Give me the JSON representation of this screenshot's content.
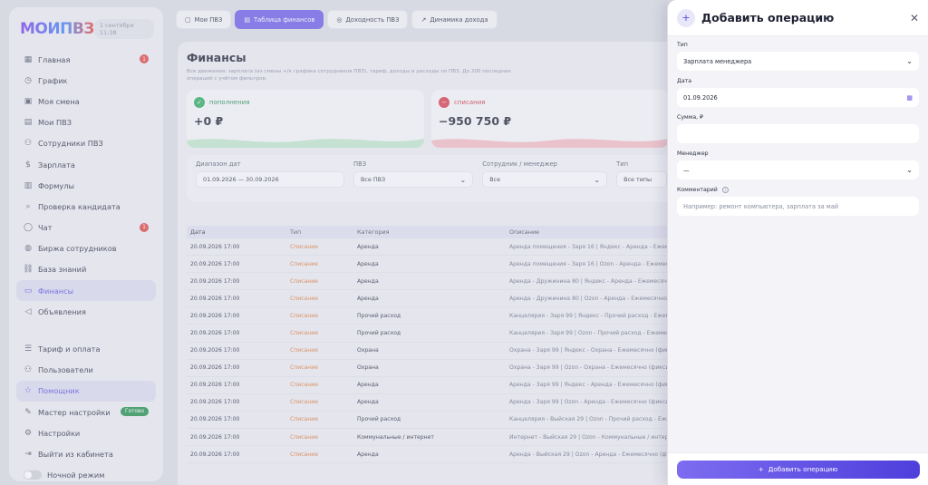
{
  "app": {
    "logo": "МОИПВЗ",
    "date": "1 сентября 11:38"
  },
  "sidebar": {
    "items": [
      {
        "name": "glavnaya",
        "icon": "grid",
        "label": "Главная",
        "badge": "1"
      },
      {
        "name": "grafik",
        "icon": "clock",
        "label": "График"
      },
      {
        "name": "moya-smena",
        "icon": "calendar",
        "label": "Моя смена"
      },
      {
        "name": "moi-pvz",
        "icon": "boxes",
        "label": "Мои ПВЗ"
      },
      {
        "name": "sotrudniki",
        "icon": "people",
        "label": "Сотрудники ПВЗ"
      },
      {
        "name": "zarplata",
        "icon": "dollar",
        "label": "Зарплата"
      },
      {
        "name": "formuly",
        "icon": "calc",
        "label": "Формулы"
      },
      {
        "name": "proverka",
        "icon": "search",
        "label": "Проверка кандидата"
      },
      {
        "name": "chat",
        "icon": "chat",
        "label": "Чат",
        "badge": "1"
      },
      {
        "name": "birzha",
        "icon": "globe",
        "label": "Биржа сотрудников"
      },
      {
        "name": "baza",
        "icon": "link",
        "label": "База знаний"
      },
      {
        "name": "finansy",
        "icon": "wallet",
        "label": "Финансы",
        "active": true
      },
      {
        "name": "obyavleniya",
        "icon": "megaphone",
        "label": "Объявления"
      }
    ],
    "items2": [
      {
        "name": "tarif",
        "icon": "list",
        "label": "Тариф и оплата"
      },
      {
        "name": "polzovateli",
        "icon": "users",
        "label": "Пользователи"
      },
      {
        "name": "pomoshnik",
        "icon": "star",
        "label": "Помощник",
        "active": true
      },
      {
        "name": "master",
        "icon": "pencil",
        "label": "Мастер настройки",
        "ready": "Готово"
      },
      {
        "name": "nastroyki",
        "icon": "gear",
        "label": "Настройки"
      },
      {
        "name": "vyiti",
        "icon": "exit",
        "label": "Выйти из кабинета"
      }
    ],
    "night_mode": "Ночной режим"
  },
  "tabs": [
    {
      "icon": "box",
      "label": "Мои ПВЗ"
    },
    {
      "icon": "table",
      "label": "Таблица финансов",
      "active": true
    },
    {
      "icon": "coins",
      "label": "Доходность ПВЗ"
    },
    {
      "icon": "trend",
      "label": "Динамика дохода"
    }
  ],
  "finance": {
    "title": "Финансы",
    "subtitle": "Все движения: зарплата (из смены +/к графика сотрудников ПВЗ), тариф, доходы и расходы по ПВЗ. До 200 последних операций с учётом фильтров.",
    "income_label": "пополнения",
    "income_value": "+0 ₽",
    "expense_label": "списания",
    "expense_value": "−950 750 ₽",
    "filters": {
      "range_label": "Диапазон дат",
      "range_value": "01.09.2026 — 30.09.2026",
      "pvz_label": "ПВЗ",
      "pvz_value": "Все ПВЗ",
      "employee_label": "Сотрудник / менеджер",
      "employee_value": "Все",
      "type_label": "Тип",
      "type_value": "Все типы"
    },
    "columns": [
      "Дата",
      "Тип",
      "Категория",
      "Описание"
    ],
    "rows": [
      [
        "20.09.2026 17:00",
        "Списание",
        "Аренда",
        "Аренда помещения - Заря 16 | Яндекс - Аренда - Ежемесячно (фиксир"
      ],
      [
        "20.09.2026 17:00",
        "Списание",
        "Аренда",
        "Аренда помещения - Заря 16 | Ozon - Аренда - Ежемесячно (фиксир"
      ],
      [
        "20.09.2026 17:00",
        "Списание",
        "Аренда",
        "Аренда - Дружинина 80 | Яндекс - Аренда - Ежемесячно (фиксир"
      ],
      [
        "20.09.2026 17:00",
        "Списание",
        "Аренда",
        "Аренда - Дружинина 80 | Ozon - Аренда - Ежемесячно (фиксир"
      ],
      [
        "20.09.2026 17:00",
        "Списание",
        "Прочий расход",
        "Канцелярия - Заря 99 | Яндекс - Прочий расход - Ежемесячно"
      ],
      [
        "20.09.2026 17:00",
        "Списание",
        "Прочий расход",
        "Канцелярия - Заря 99 | Ozon - Прочий расход - Ежемесячно"
      ],
      [
        "20.09.2026 17:00",
        "Списание",
        "Охрана",
        "Охрана - Заря 99 | Яндекс - Охрана - Ежемесячно (фиксир"
      ],
      [
        "20.09.2026 17:00",
        "Списание",
        "Охрана",
        "Охрана - Заря 99 | Ozon - Охрана - Ежемесячно (фиксир"
      ],
      [
        "20.09.2026 17:00",
        "Списание",
        "Аренда",
        "Аренда - Заря 99 | Яндекс - Аренда - Ежемесячно (фиксир"
      ],
      [
        "20.09.2026 17:00",
        "Списание",
        "Аренда",
        "Аренда - Заря 99 | Ozon - Аренда - Ежемесячно (фиксир"
      ],
      [
        "20.09.2026 17:00",
        "Списание",
        "Прочий расход",
        "Канцелярия - Выйская 29 | Ozon - Прочий расход - Ежемесячно"
      ],
      [
        "20.09.2026 17:00",
        "Списание",
        "Коммунальные / интернет",
        "Интернет - Выйская 29 | Ozon - Коммунальные / интернет - Ежем"
      ],
      [
        "20.09.2026 17:00",
        "Списание",
        "Аренда",
        "Аренда - Выйская 29 | Ozon - Аренда - Ежемесячно (фиксир"
      ]
    ]
  },
  "drawer": {
    "title": "Добавить операцию",
    "type_label": "Тип",
    "type_value": "Зарплата менеджера",
    "date_label": "Дата",
    "date_value": "01.09.2026",
    "sum_label": "Сумма, ₽",
    "sum_value": "",
    "manager_label": "Менеджер",
    "manager_value": "—",
    "comment_label": "Комментарий",
    "comment_placeholder": "Например: ремонт компьютера, зарплата за май",
    "submit_label": "Добавить операцию"
  },
  "colors": {
    "accent": "#6d5ce8",
    "income": "#2cab62",
    "expense": "#d93c4b",
    "type_text": "#e07a36"
  }
}
